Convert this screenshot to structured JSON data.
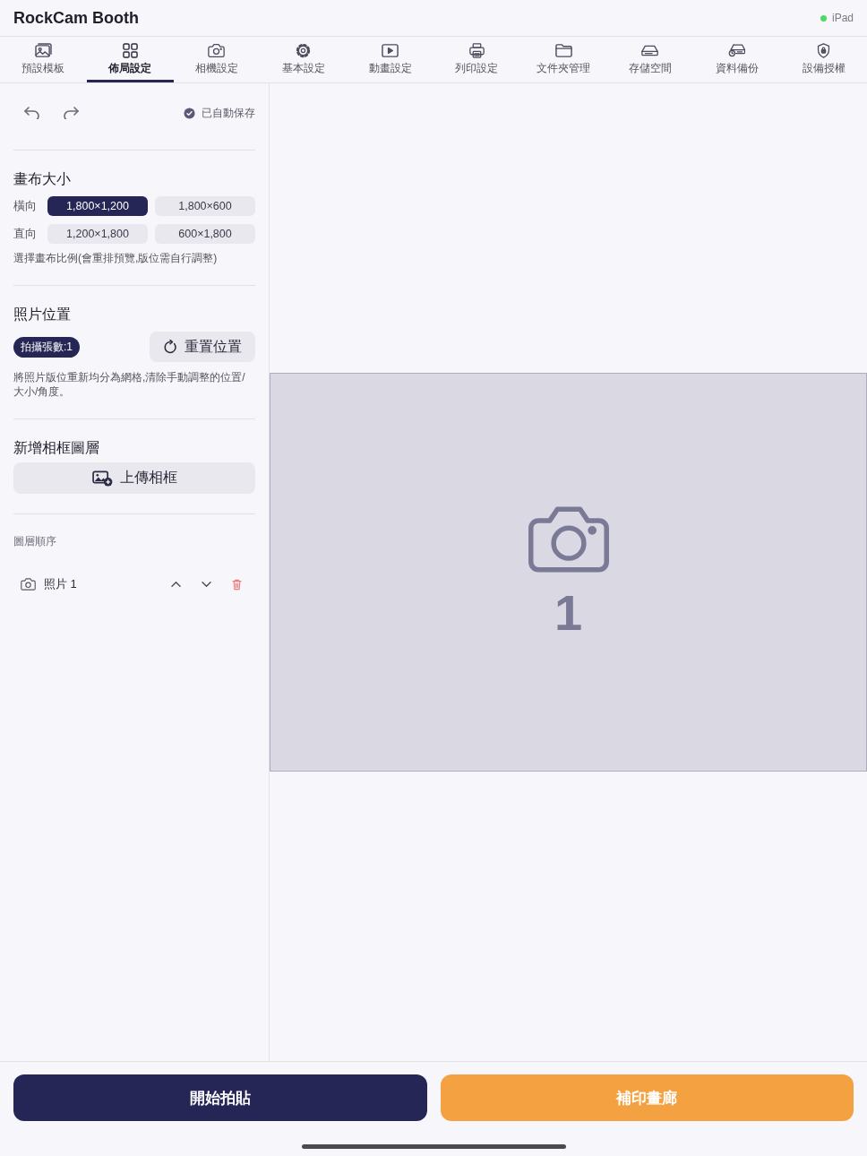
{
  "app": {
    "title": "RockCam Booth"
  },
  "device": {
    "name": "iPad",
    "connected": true
  },
  "tabs": [
    {
      "label": "預設模板",
      "selected": false
    },
    {
      "label": "佈局設定",
      "selected": true
    },
    {
      "label": "相機設定",
      "selected": false
    },
    {
      "label": "基本設定",
      "selected": false
    },
    {
      "label": "動畫設定",
      "selected": false
    },
    {
      "label": "列印設定",
      "selected": false
    },
    {
      "label": "文件夾管理",
      "selected": false
    },
    {
      "label": "存儲空間",
      "selected": false
    },
    {
      "label": "資料備份",
      "selected": false
    },
    {
      "label": "設備授權",
      "selected": false
    }
  ],
  "toolbar": {
    "autosave_status": "已自動保存"
  },
  "canvas_size": {
    "heading": "畫布大小",
    "rows": [
      {
        "label": "橫向",
        "options": [
          {
            "label": "1,800×1,200",
            "selected": true
          },
          {
            "label": "1,800×600",
            "selected": false
          }
        ]
      },
      {
        "label": "直向",
        "options": [
          {
            "label": "1,200×1,800",
            "selected": false
          },
          {
            "label": "600×1,800",
            "selected": false
          }
        ]
      }
    ],
    "hint": "選擇畫布比例(會重排預覽,版位需自行調整)"
  },
  "photo_position": {
    "heading": "照片位置",
    "count_badge": "拍攝張數:1",
    "reset_button": "重置位置",
    "description": "將照片版位重新均分為網格,清除手動調整的位置/大小/角度。"
  },
  "frame_layer": {
    "heading": "新增相框圖層",
    "upload_button": "上傳相框"
  },
  "layer_order": {
    "label": "圖層順序",
    "layers": [
      {
        "name": "照片 1"
      }
    ]
  },
  "preview": {
    "slots": [
      {
        "number": "1"
      }
    ]
  },
  "actions": [
    {
      "label": "開始拍貼",
      "kind": "primary"
    },
    {
      "label": "補印畫廊",
      "kind": "accent"
    }
  ]
}
